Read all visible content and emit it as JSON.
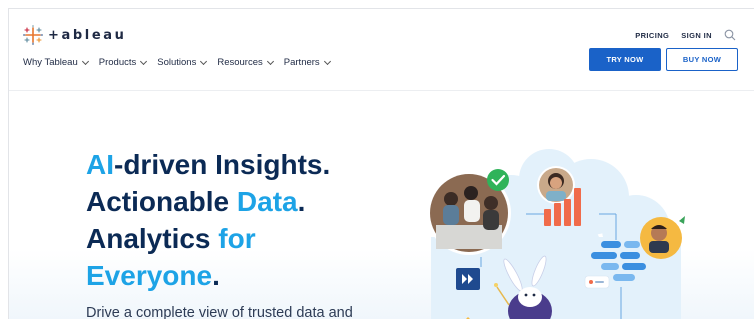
{
  "header": {
    "logo_text": "+ableau",
    "utility": {
      "pricing": "PRICING",
      "sign_in": "SIGN IN"
    },
    "nav": [
      {
        "label": "Why Tableau"
      },
      {
        "label": "Products"
      },
      {
        "label": "Solutions"
      },
      {
        "label": "Resources"
      },
      {
        "label": "Partners"
      }
    ],
    "try_now": "TRY NOW",
    "buy_now": "BUY NOW"
  },
  "hero": {
    "line1_accent": "AI",
    "line1_rest": "-driven Insights.",
    "line2_a": "Actionable ",
    "line2_accent": "Data",
    "line2_b": ".",
    "line3_a": "Analytics ",
    "line3_accent": "for",
    "line4_accent": "Everyone",
    "line4_b": ".",
    "subtitle": "Drive a complete view of trusted data and"
  },
  "colors": {
    "brand_blue": "#1a62c8",
    "accent_cyan": "#1da3e6",
    "navy": "#0b2a55",
    "bar_orange": "#f06b4a",
    "check_green": "#2fb35a"
  },
  "icons": {
    "logo": "tableau-plus-mark-icon",
    "search": "search-icon",
    "chevron": "chevron-down-icon",
    "check": "check-icon",
    "forward": "fast-forward-icon"
  }
}
